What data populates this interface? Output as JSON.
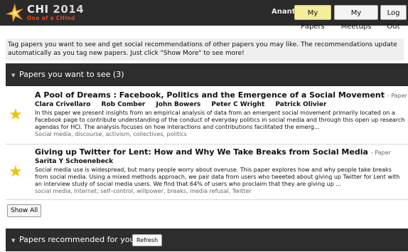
{
  "header": {
    "logo_text": "CHI",
    "logo_year": "2014",
    "logo_tagline": "One of a CHInd",
    "username": "Anant",
    "nav": [
      {
        "label": "My Papers",
        "active": true
      },
      {
        "label": "My Meetups",
        "active": false
      },
      {
        "label": "Log Out",
        "active": false
      }
    ]
  },
  "intro": "Tag papers you want to see and get social recommendations of other papers you may like. The recommendations update automatically as you tag new papers. Just click \"Show More\" to see more!",
  "section_want": {
    "title": "Papers you want to see (3)"
  },
  "papers": [
    {
      "title": "A Pool of Dreams : Facebook, Politics and the Emergence of a Social Movement",
      "type": "- Paper",
      "authors": [
        "Clara Crivellaro",
        "Rob Comber",
        "John Bowers",
        "Peter C Wright",
        "Patrick Olivier"
      ],
      "abstract": "In this paper we present insights from an empirical analysis of data from an emergent social movement primarily located on a Facebook page to contribute understanding of the conduct of everyday politics in social media and through this open up research agendas for HCI. The analysis focuses on how interactions and contributions facilitated the emerg...",
      "keywords": "Social media, discourse, activism, collectives, politics",
      "starred": true
    },
    {
      "title": "Giving up Twitter for Lent: How and Why We Take Breaks from Social Media",
      "type": "- Paper",
      "authors": [
        "Sarita Y Schoenebeck"
      ],
      "abstract": "Social media use is widespread, but many people worry about overuse. This paper explores how and why people take breaks from social media. Using a mixed methods approach, we pair data from users who tweeted about giving up Twitter for Lent with an interview study of social media users. We find that 64% of users who proclaim that they are giving up ...",
      "keywords": "social media, Internet, self–control, willpower, breaks, media refusal, Twitter",
      "starred": true
    }
  ],
  "show_all_label": "Show All",
  "section_rec": {
    "title": "Papers recommended for you",
    "refresh_label": "Refresh"
  },
  "colors": {
    "star": "#f2c200",
    "active_nav": "#f2ee9c",
    "bar": "#2d2d2d",
    "accent": "#e04a1f"
  }
}
